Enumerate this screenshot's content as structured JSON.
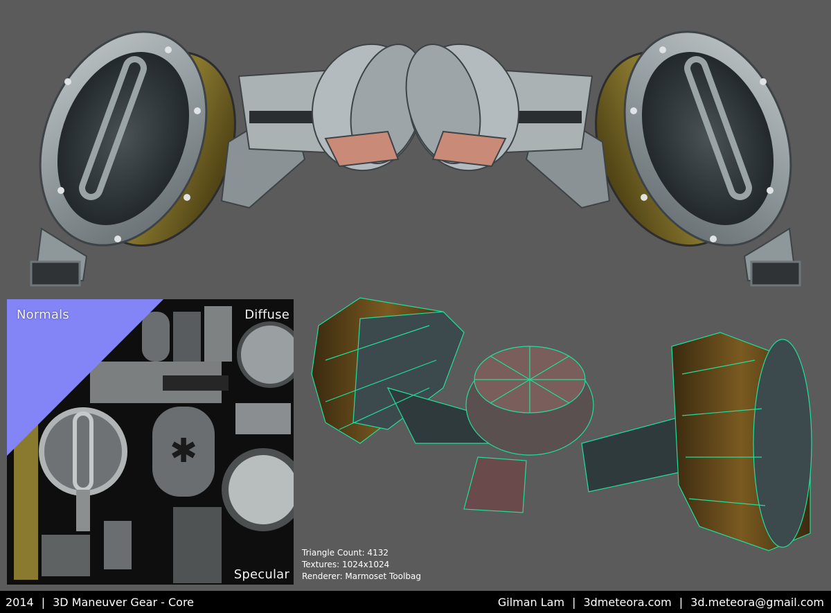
{
  "texture_labels": {
    "normals": "Normals",
    "diffuse": "Diffuse",
    "specular": "Specular"
  },
  "specs": {
    "triangles": "Triangle Count: 4132",
    "textures": "Textures: 1024x1024",
    "renderer": "Renderer: Marmoset Toolbag"
  },
  "footer": {
    "year": "2014",
    "title": "3D Maneuver Gear - Core",
    "author": "Gilman Lam",
    "website": "3dmeteora.com",
    "email": "3d.meteora@gmail.com",
    "separator": "|"
  },
  "colors": {
    "background": "#5b5b5b",
    "metal": "#9aa3a6",
    "spool": "#7a6a24",
    "wire": "#1fe09a",
    "normals": "#8080ff",
    "footer": "#000000"
  }
}
